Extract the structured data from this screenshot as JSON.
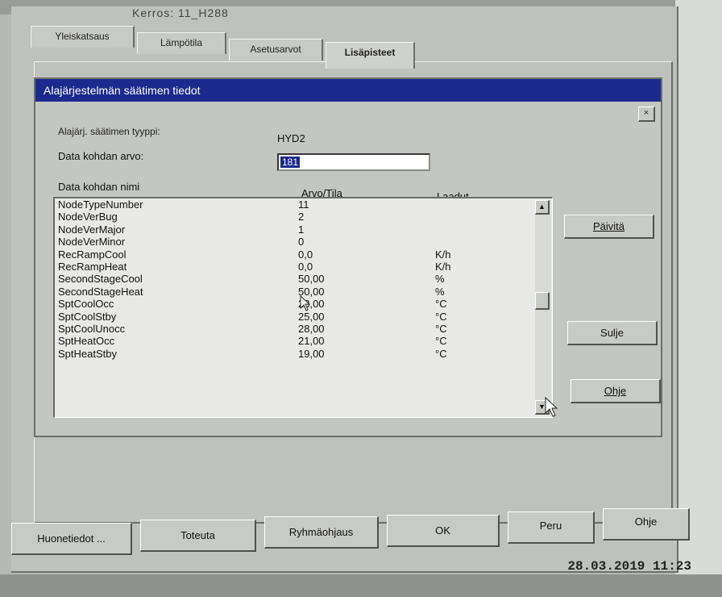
{
  "header": {
    "text": "Kerros:   11_H288"
  },
  "tabs": [
    {
      "label": "Yleiskatsaus"
    },
    {
      "label": "Lämpötila"
    },
    {
      "label": "Asetusarvot"
    },
    {
      "label": "Lisäpisteet"
    }
  ],
  "dialog": {
    "title": "Alajärjestelmän säätimen tiedot",
    "close_glyph": "×",
    "type_label": "Alajärj. säätimen tyyppi:",
    "type_value": "HYD2",
    "data_value_label": "Data kohdan arvo:",
    "data_value_input": "181",
    "columns": [
      "Data kohdan nimi",
      "Arvo/Tila",
      "Laadut"
    ],
    "rows": [
      [
        "NodeTypeNumber",
        "11",
        ""
      ],
      [
        "NodeVerBug",
        "2",
        ""
      ],
      [
        "NodeVerMajor",
        "1",
        ""
      ],
      [
        "NodeVerMinor",
        "0",
        ""
      ],
      [
        "RecRampCool",
        "0,0",
        "K/h"
      ],
      [
        "RecRampHeat",
        "0,0",
        "K/h"
      ],
      [
        "SecondStageCool",
        "50,00",
        "%"
      ],
      [
        "SecondStageHeat",
        "50,00",
        "%"
      ],
      [
        "SptCoolOcc",
        "23,00",
        "°C"
      ],
      [
        "SptCoolStby",
        "25,00",
        "°C"
      ],
      [
        "SptCoolUnocc",
        "28,00",
        "°C"
      ],
      [
        "SptHeatOcc",
        "21,00",
        "°C"
      ],
      [
        "SptHeatStby",
        "19,00",
        "°C"
      ]
    ],
    "buttons": {
      "refresh": "Päivitä",
      "close": "Sulje",
      "help": "Ohje"
    }
  },
  "footer_buttons": {
    "room_info": "Huonetiedot ...",
    "execute": "Toteuta",
    "group_control": "Ryhmäohjaus",
    "ok": "OK",
    "cancel": "Peru",
    "help": "Ohje"
  },
  "status": {
    "datetime": "28.03.2019 11:23"
  },
  "colors": {
    "titlebar": "#1b2a8c",
    "selection": "#1b2a8c",
    "window": "#c4c6c1"
  }
}
